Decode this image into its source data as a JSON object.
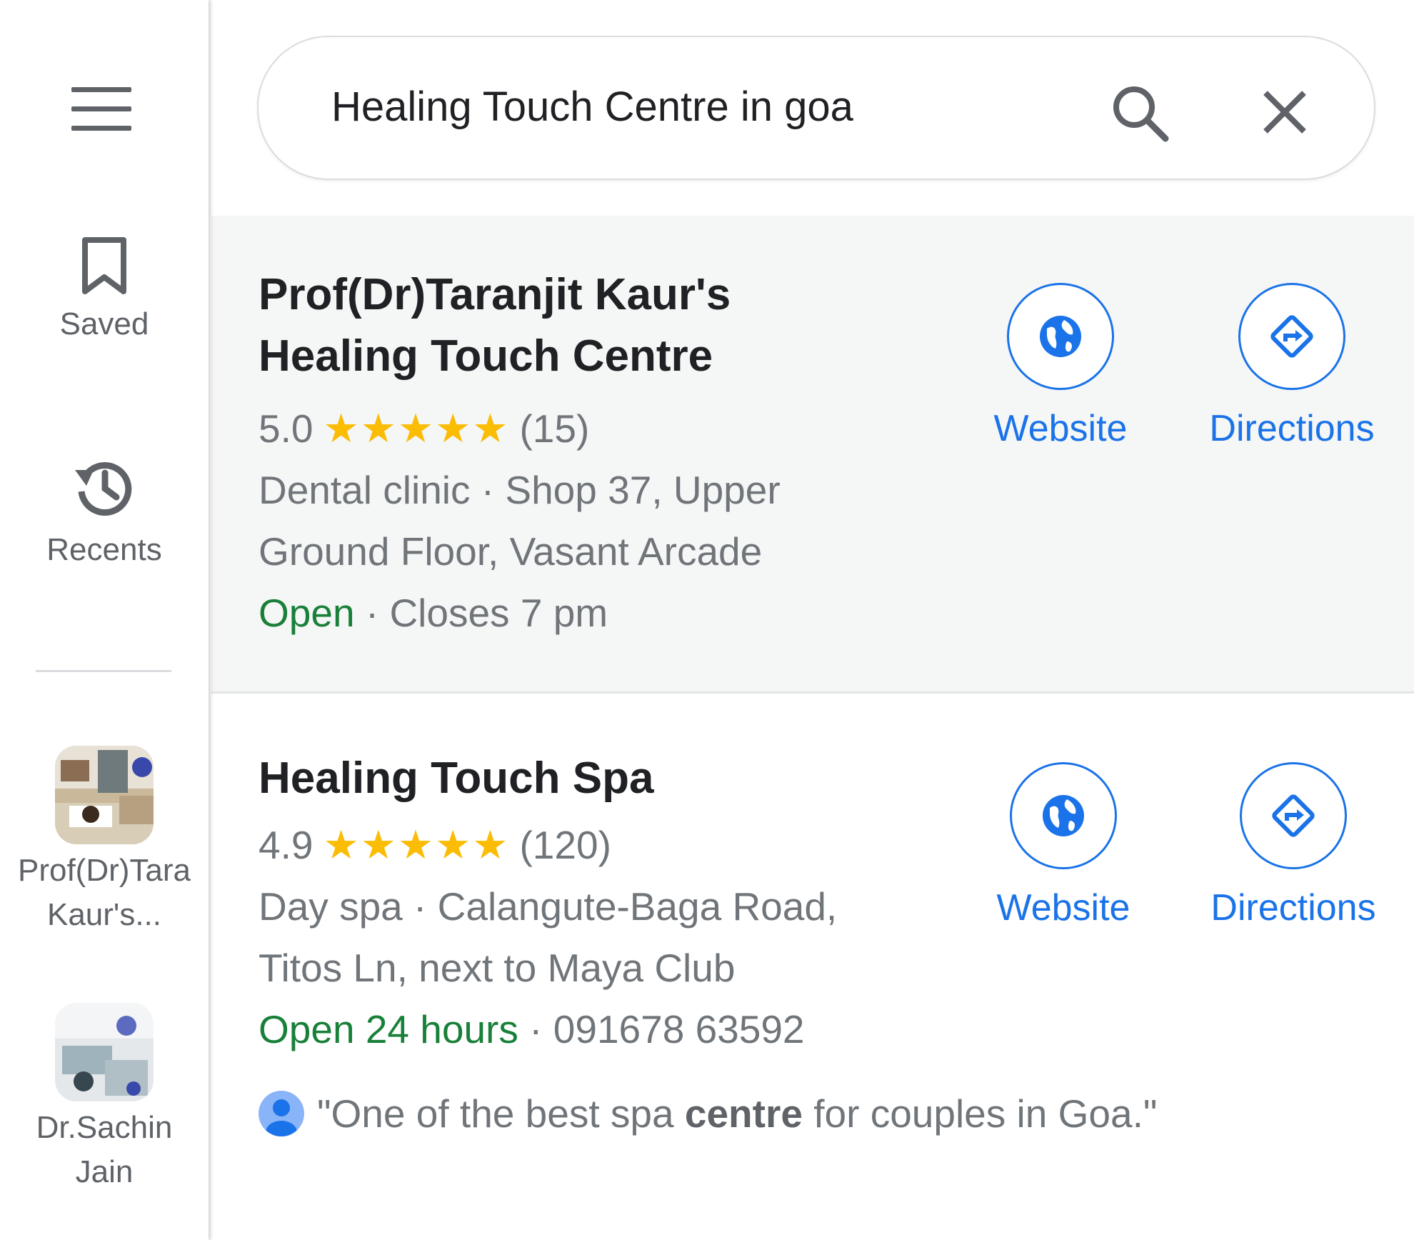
{
  "rail": {
    "saved_label": "Saved",
    "recents_label": "Recents",
    "recent_places": [
      {
        "label_line1": "Prof(Dr)Tara",
        "label_line2": "Kaur's..."
      },
      {
        "label_line1": "Dr.Sachin",
        "label_line2": "Jain"
      }
    ]
  },
  "search": {
    "value": "Healing Touch Centre in goa"
  },
  "results": [
    {
      "title_line1": "Prof(Dr)Taranjit Kaur's",
      "title_line2": "Healing Touch Centre",
      "rating": "5.0",
      "stars": "★★★★★",
      "reviews": "(15)",
      "category": "Dental clinic",
      "address_line1": "Shop 37, Upper",
      "address_line2": "Ground Floor, Vasant Arcade",
      "status": "Open",
      "hours": "Closes 7 pm",
      "website_label": "Website",
      "directions_label": "Directions"
    },
    {
      "title_line1": "Healing Touch Spa",
      "rating": "4.9",
      "stars": "★★★★★",
      "reviews": "(120)",
      "category": "Day spa",
      "address_line1": "Calangute-Baga Road,",
      "address_line2": "Titos Ln, next to Maya Club",
      "status": "Open 24 hours",
      "phone": "091678 63592",
      "website_label": "Website",
      "directions_label": "Directions",
      "review_before": "\"One of the best spa ",
      "review_bold": "centre",
      "review_after": " for couples in Goa.\""
    }
  ],
  "colors": {
    "accent": "#1a73e8",
    "star": "#fbbc04",
    "open": "#188038",
    "secondary_text": "#70757a"
  },
  "icons": [
    "menu-icon",
    "bookmark-icon",
    "history-icon",
    "search-icon",
    "close-icon",
    "globe-icon",
    "directions-icon",
    "user-avatar-icon"
  ]
}
